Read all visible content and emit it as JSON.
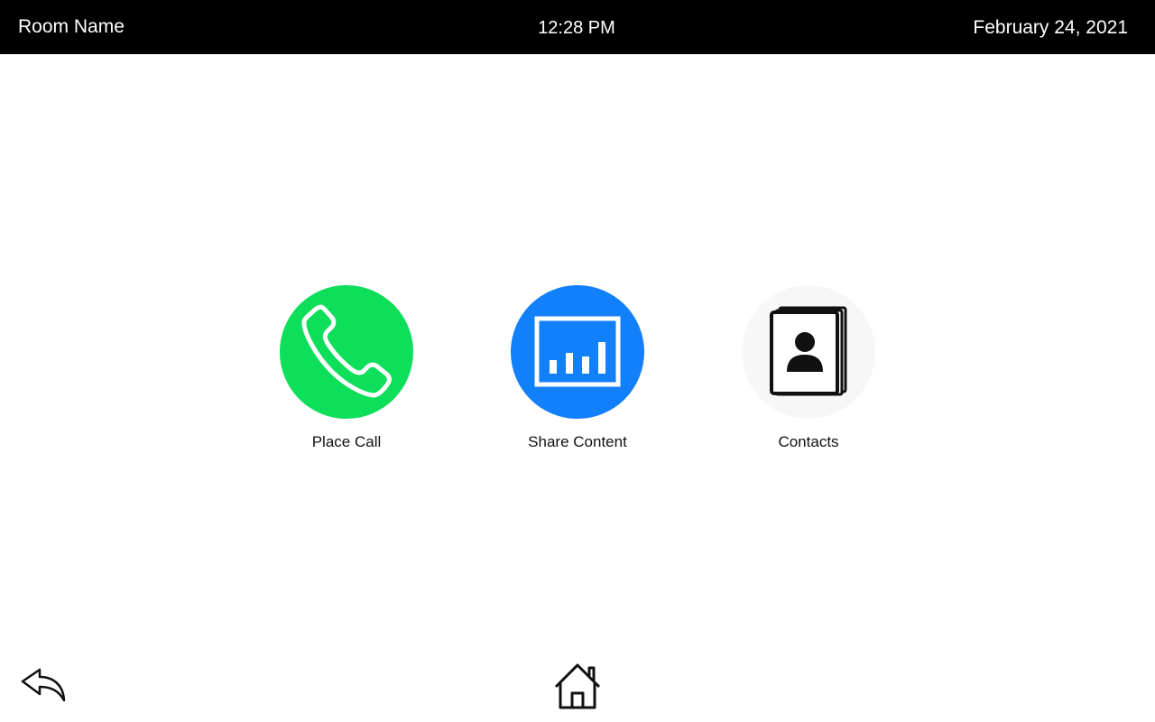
{
  "header": {
    "room_name": "Room Name",
    "time": "12:28 PM",
    "date": "February 24, 2021"
  },
  "tiles": [
    {
      "label": "Place Call",
      "icon": "phone-icon",
      "color": "#0edf5b"
    },
    {
      "label": "Share Content",
      "icon": "presentation-chart-icon",
      "color": "#127ffb"
    },
    {
      "label": "Contacts",
      "icon": "contact-book-icon",
      "color": "#f7f7f7"
    }
  ],
  "footer": {
    "back_icon": "back-arrow-icon",
    "home_icon": "home-icon"
  }
}
